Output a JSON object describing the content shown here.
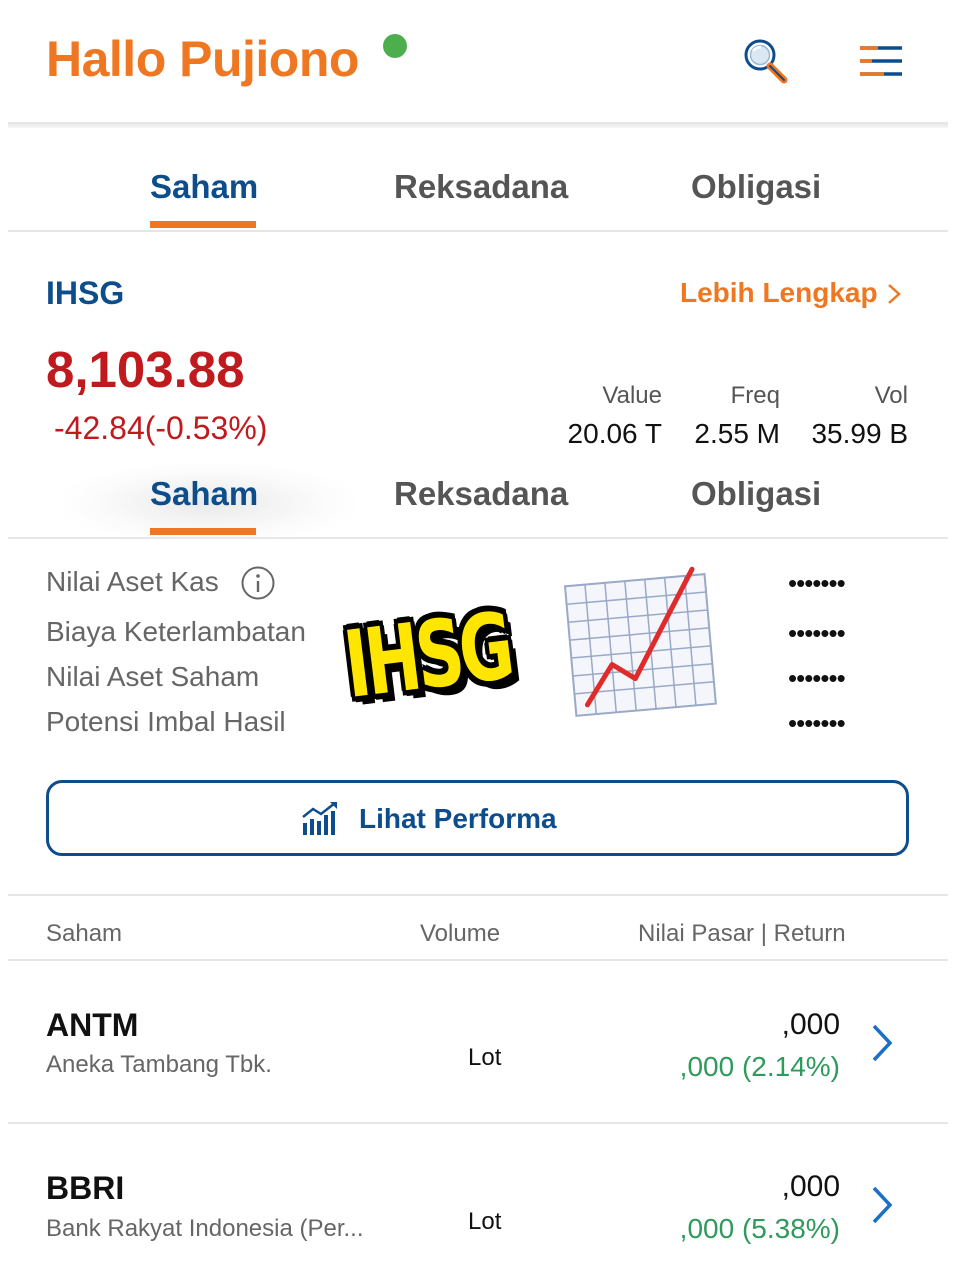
{
  "header": {
    "greeting": "Hallo Pujiono",
    "online_color": "#4cae4c",
    "icons": [
      "search-icon",
      "menu-icon"
    ]
  },
  "tabs_top": {
    "items": [
      {
        "label": "Saham",
        "active": true
      },
      {
        "label": "Reksadana",
        "active": false
      },
      {
        "label": "Obligasi",
        "active": false
      }
    ]
  },
  "index": {
    "name": "IHSG",
    "more_link": "Lebih Lengkap",
    "value": "8,103.88",
    "change": "-42.84(-0.53%)",
    "stats": [
      {
        "label": "Value",
        "value": "20.06 T"
      },
      {
        "label": "Freq",
        "value": "2.55 M"
      },
      {
        "label": "Vol",
        "value": "35.99 B"
      }
    ]
  },
  "tabs_second": {
    "items": [
      {
        "label": "Saham",
        "active": true
      },
      {
        "label": "Reksadana",
        "active": false
      },
      {
        "label": "Obligasi",
        "active": false
      }
    ]
  },
  "assets": [
    {
      "label": "Nilai Aset Kas",
      "value": "•••••••"
    },
    {
      "label": "Biaya Keterlambatan",
      "value": "•••••••"
    },
    {
      "label": "Nilai Aset Saham",
      "value": "•••••••"
    },
    {
      "label": "Potensi Imbal Hasil",
      "value": "•••••••"
    }
  ],
  "sticker": {
    "text": "IHSG",
    "emoji": "chart-increasing-icon"
  },
  "performance_button": "Lihat Performa",
  "table": {
    "headers": [
      "Saham",
      "Volume",
      "Nilai Pasar | Return"
    ],
    "rows": [
      {
        "ticker": "ANTM",
        "company": "Aneka Tambang Tbk.",
        "volume_unit": "Lot",
        "market_value": ",000",
        "return": ",000 (2.14%)"
      },
      {
        "ticker": "BBRI",
        "company": "Bank Rakyat Indonesia (Per...",
        "volume_unit": "Lot",
        "market_value": ",000",
        "return": ",000 (5.38%)"
      }
    ]
  },
  "colors": {
    "brand_orange": "#f07722",
    "brand_blue": "#0d4d8c",
    "negative_red": "#c0191e",
    "positive_green": "#2e9a5c"
  }
}
